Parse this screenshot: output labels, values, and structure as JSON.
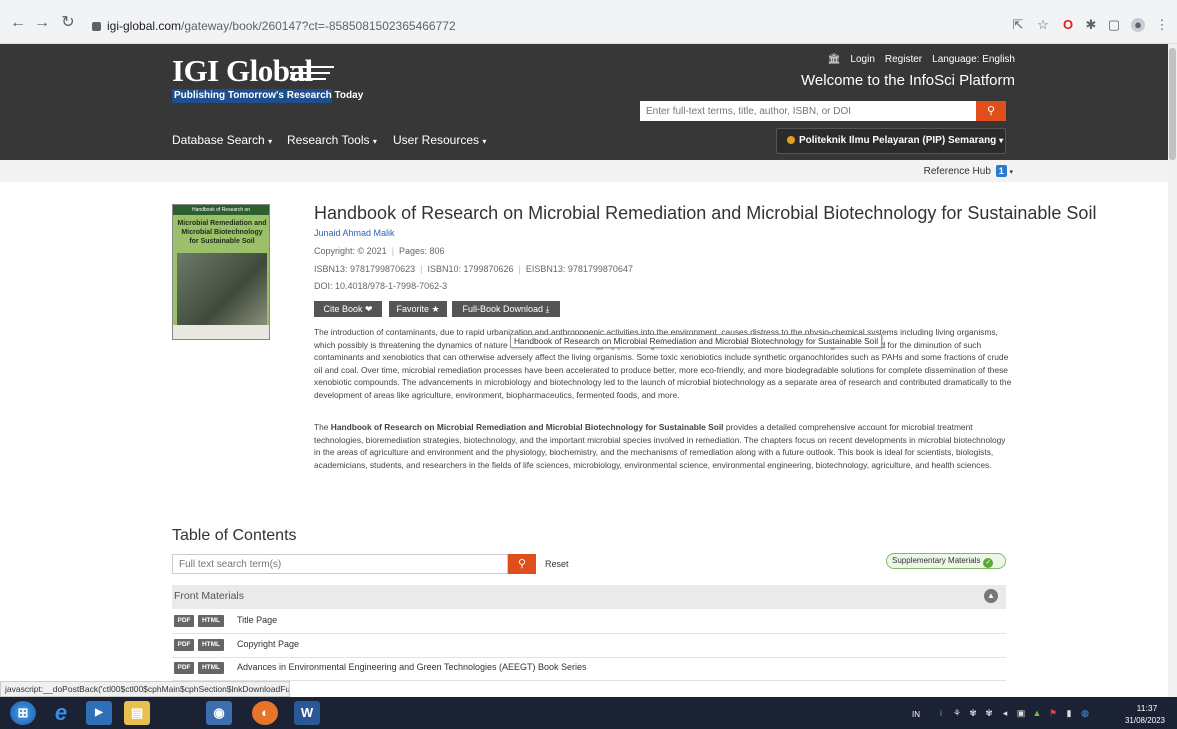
{
  "browser": {
    "url_host": "igi-global.com",
    "url_path": "/gateway/book/260147?ct=-8585081502365466772",
    "icons": [
      "back-icon",
      "forward-icon",
      "reload-icon",
      "lock-icon",
      "share-icon",
      "star-icon",
      "opera-icon",
      "extensions-icon",
      "sidepanel-icon",
      "profile-icon",
      "menu-icon"
    ]
  },
  "header": {
    "logo_main": "IGI Global",
    "logo_tagline": "Publishing Tomorrow's Research Today",
    "login": "Login",
    "register": "Register",
    "language": "Language: English",
    "welcome": "Welcome to the InfoSci Platform",
    "search_placeholder": "Enter full-text terms, title, author, ISBN, or DOI",
    "nav": {
      "database_search": "Database Search",
      "research_tools": "Research Tools",
      "user_resources": "User Resources"
    },
    "institution": "Politeknik Ilmu Pelayaran (PIP) Semarang"
  },
  "ref_hub": {
    "label": "Reference Hub",
    "count": "1"
  },
  "book": {
    "cover": {
      "series": "Handbook of Research on",
      "title": "Microbial Remediation and Microbial Biotechnology for Sustainable Soil"
    },
    "title": "Handbook of Research on Microbial Remediation and Microbial Biotechnology for Sustainable Soil",
    "author": "Junaid Ahmad Malik",
    "copyright": "Copyright: © 2021",
    "pages": "Pages: 806",
    "isbn13": "ISBN13: 9781799870623",
    "isbn10": "ISBN10: 1799870626",
    "eisbn13": "EISBN13: 9781799870647",
    "doi": "DOI: 10.4018/978-1-7998-7062-3",
    "buttons": {
      "cite": "Cite Book ❤",
      "favorite": "Favorite ★",
      "download": "Full-Book Download ⤓"
    },
    "tooltip": "Handbook of Research on Microbial Remediation and Microbial Biotechnology for Sustainable Soil",
    "para1": "The introduction of contaminants, due to rapid urbanization and anthropogenic activities into the environment, causes distress to the physio-chemical systems including living organisms, which possibly is threatening the dynamics of nature as well as the soil biology by producing certain hazards. Hence, there is an immediate global demand for the diminution of such contaminants and xenobiotics that can otherwise adversely affect the living organisms. Some toxic xenobiotics include synthetic organochlorides such as PAHs and some fractions of crude oil and coal. Over time, microbial remediation processes have been accelerated to produce better, more eco-friendly, and more biodegradable solutions for complete dissemination of these xenobiotic compounds. The advancements in microbiology and biotechnology led to the launch of microbial biotechnology as a separate area of research and contributed dramatically to the development of areas like agriculture, environment, biopharmaceutics, fermented foods, and more.",
    "para2_bold": "Handbook of Research on Microbial Remediation and Microbial Biotechnology for Sustainable Soil",
    "para2_pre": "The ",
    "para2_rest": " provides a detailed comprehensive account for microbial treatment technologies, bioremediation strategies, biotechnology, and the important microbial species involved in remediation. The chapters focus on recent developments in microbial biotechnology in the areas of agriculture and environment and the physiology, biochemistry, and the mechanisms of remediation along with a future outlook. This book is ideal for scientists, biologists, academicians, students, and researchers in the fields of life sciences, microbiology, environmental science, environmental engineering, biotechnology, agriculture, and health sciences."
  },
  "toc": {
    "heading": "Table of Contents",
    "search_placeholder": "Full text search term(s)",
    "reset": "Reset",
    "supplementary": "Supplementary Materials",
    "section": "Front Materials",
    "rows": [
      {
        "pdf": "PDF",
        "html": "HTML",
        "title": "Title Page"
      },
      {
        "pdf": "PDF",
        "html": "HTML",
        "title": "Copyright Page"
      },
      {
        "pdf": "PDF",
        "html": "HTML",
        "title": "Advances in Environmental Engineering and Green Technologies (AEEGT) Book Series"
      }
    ]
  },
  "status_bar": "javascript:__doPostBack('ctl00$ctl00$cphMain$cphSection$lnkDownloadFullPdf','')",
  "taskbar": {
    "lang": "IN",
    "time": "11:37",
    "date": "31/08/2023"
  },
  "colors": {
    "header_bg": "#373737",
    "accent_orange": "#e04e1c",
    "link_blue": "#2a66b8"
  }
}
